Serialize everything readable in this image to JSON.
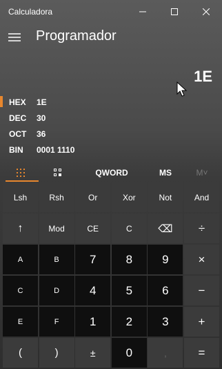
{
  "window": {
    "title": "Calculadora"
  },
  "header": {
    "mode": "Programador"
  },
  "display": {
    "value": "1E"
  },
  "radix": [
    {
      "name": "HEX",
      "value": "1E",
      "active": true
    },
    {
      "name": "DEC",
      "value": "30",
      "active": false
    },
    {
      "name": "OCT",
      "value": "36",
      "active": false
    },
    {
      "name": "BIN",
      "value": "0001 1110",
      "active": false
    }
  ],
  "tabs": {
    "word_size": "QWORD",
    "memory_store": "MS",
    "memory_list": "M˅"
  },
  "keys": {
    "row1": [
      "Lsh",
      "Rsh",
      "Or",
      "Xor",
      "Not",
      "And"
    ],
    "row2": [
      "↑",
      "Mod",
      "CE",
      "C",
      "⌫",
      "÷"
    ],
    "row3": [
      "A",
      "B",
      "7",
      "8",
      "9",
      "×"
    ],
    "row4": [
      "C",
      "D",
      "4",
      "5",
      "6",
      "−"
    ],
    "row5": [
      "E",
      "F",
      "1",
      "2",
      "3",
      "+"
    ],
    "row6": [
      "(",
      ")",
      "±",
      "0",
      ",",
      "="
    ]
  },
  "colors": {
    "accent": "#e8872e",
    "digit_key": "#0f0f0f",
    "function_key": "#3b3b3b"
  }
}
